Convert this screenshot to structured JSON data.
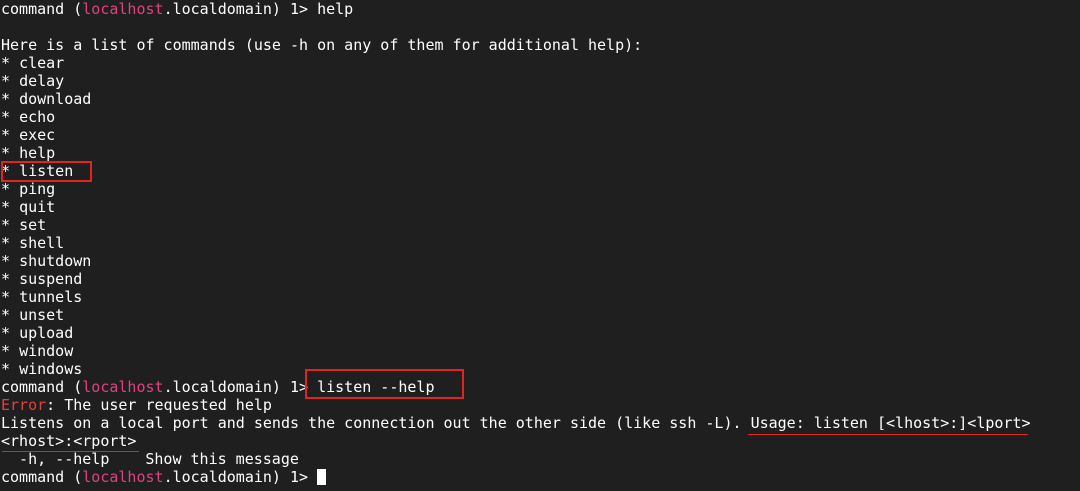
{
  "terminal": {
    "prompt": {
      "prefix": "command (",
      "host": "localhost",
      "suffix": ".localdomain) 1> "
    },
    "first_command": "help",
    "help_header": "Here is a list of commands (use -h on any of them for additional help):",
    "bullet": "* ",
    "commands": [
      "clear",
      "delay",
      "download",
      "echo",
      "exec",
      "help",
      "listen",
      "ping",
      "quit",
      "set",
      "shell",
      "shutdown",
      "suspend",
      "tunnels",
      "unset",
      "upload",
      "window",
      "windows"
    ],
    "second_command": "listen --help",
    "error_label": "Error",
    "error_message": ": The user requested help",
    "desc_main": "Listens on a local port and sends the connection out the other side (like ssh -L). ",
    "usage_text": "Usage: listen [<lhost>:]<lport>",
    "usage_cont": "<rhost>:<rport>",
    "option_flags": "  -h, --help",
    "option_desc": "Show this message"
  },
  "annotations": {
    "color": "#e02424",
    "highlighted_command": "listen"
  }
}
